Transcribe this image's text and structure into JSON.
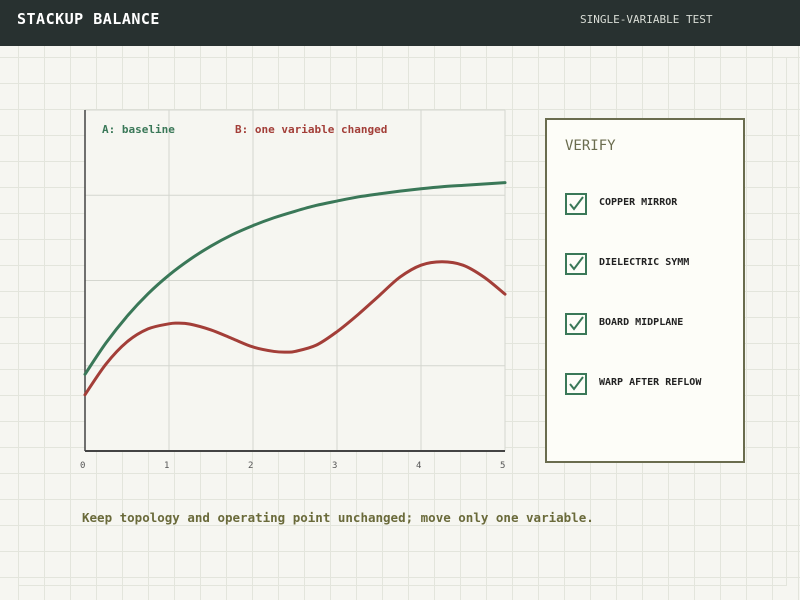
{
  "header": {
    "title": "STACKUP BALANCE",
    "subtitle": "SINGLE-VARIABLE TEST"
  },
  "chart_data": {
    "type": "line",
    "x_ticks": [
      "0",
      "1",
      "2",
      "3",
      "4",
      "5"
    ],
    "xlim": [
      0,
      5
    ],
    "ylim": [
      0,
      1
    ],
    "grid": true,
    "legend_position": "top-left",
    "series": [
      {
        "name": "A: baseline",
        "color": "#3a7858",
        "x": [
          0,
          0.25,
          0.5,
          0.75,
          1,
          1.25,
          1.5,
          1.75,
          2,
          2.25,
          2.5,
          2.75,
          3,
          3.25,
          3.5,
          3.75,
          4,
          4.25,
          4.5,
          4.75,
          5
        ],
        "y": [
          0.225,
          0.317,
          0.395,
          0.461,
          0.516,
          0.562,
          0.601,
          0.634,
          0.661,
          0.684,
          0.703,
          0.72,
          0.733,
          0.745,
          0.754,
          0.762,
          0.769,
          0.775,
          0.779,
          0.783,
          0.787
        ]
      },
      {
        "name": "B: one variable changed",
        "color": "#a33e38",
        "x": [
          0,
          0.25,
          0.5,
          0.75,
          1,
          1.1,
          1.25,
          1.5,
          1.75,
          2,
          2.25,
          2.4,
          2.5,
          2.75,
          3,
          3.25,
          3.5,
          3.75,
          4,
          4.25,
          4.5,
          4.75,
          5
        ],
        "y": [
          0.165,
          0.255,
          0.32,
          0.358,
          0.373,
          0.375,
          0.372,
          0.355,
          0.33,
          0.305,
          0.292,
          0.29,
          0.292,
          0.31,
          0.35,
          0.4,
          0.455,
          0.51,
          0.545,
          0.555,
          0.545,
          0.51,
          0.46
        ]
      }
    ]
  },
  "verify": {
    "title": "VERIFY",
    "items": [
      {
        "label": "COPPER MIRROR",
        "checked": true,
        "icon": "checkmark-icon"
      },
      {
        "label": "DIELECTRIC SYMM",
        "checked": true,
        "icon": "checkmark-icon"
      },
      {
        "label": "BOARD MIDPLANE",
        "checked": true,
        "icon": "checkmark-icon"
      },
      {
        "label": "WARP AFTER REFLOW",
        "checked": true,
        "icon": "checkmark-icon"
      }
    ]
  },
  "footer": {
    "note": "Keep topology and operating point unchanged; move only one variable."
  },
  "colors": {
    "header_bg": "#283130",
    "baseline": "#3a7858",
    "changed": "#a33e38",
    "panel_border": "#6a6c4e"
  }
}
